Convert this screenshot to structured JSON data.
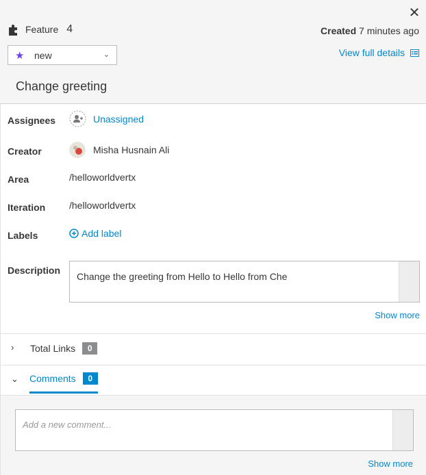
{
  "header": {
    "type_label": "Feature",
    "item_number": "4",
    "created_label": "Created",
    "created_time": "7 minutes ago",
    "state": "new",
    "view_details_label": "View full details",
    "title": "Change greeting",
    "close_glyph": "✕"
  },
  "fields": {
    "assignees": {
      "label": "Assignees",
      "value": "Unassigned"
    },
    "creator": {
      "label": "Creator",
      "value": "Misha Husnain Ali"
    },
    "area": {
      "label": "Area",
      "value": "/helloworldvertx"
    },
    "iteration": {
      "label": "Iteration",
      "value": "/helloworldvertx"
    },
    "labels": {
      "label": "Labels",
      "value": "Add label"
    },
    "description": {
      "label": "Description",
      "value": "Change the greeting from Hello to Hello from Che",
      "show_more": "Show more"
    }
  },
  "links": {
    "label": "Total Links",
    "count": "0"
  },
  "comments": {
    "label": "Comments",
    "count": "0",
    "placeholder": "Add a new comment...",
    "show_more": "Show more"
  },
  "colors": {
    "accent": "#0088ce",
    "state_star": "#703fec",
    "badge_gray": "#8b8d8f"
  },
  "icons": {
    "type": "puzzle-icon",
    "state": "star-icon",
    "details": "list-icon",
    "assignee": "add-user-icon",
    "labels": "plus-circle-icon"
  }
}
